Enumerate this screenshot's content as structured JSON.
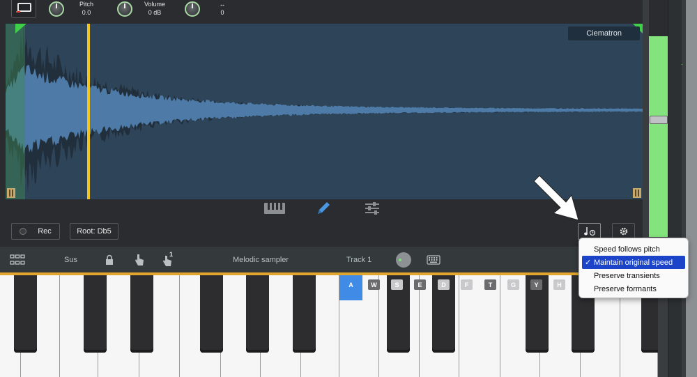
{
  "topbar": {
    "pitch": {
      "label": "Pitch",
      "value": "0.0"
    },
    "volume": {
      "label": "Volume",
      "value": "0 dB"
    },
    "pan": {
      "label": "↔",
      "value": "0"
    }
  },
  "waveform": {
    "sample_name": "Ciematron"
  },
  "modes": [
    "piano-keys-icon",
    "pencil-icon",
    "sliders-icon"
  ],
  "controls": {
    "rec_label": "Rec",
    "root_label": "Root: Db5"
  },
  "toolbar": {
    "sus_label": "Sus",
    "latch_badge": "1",
    "instrument_label": "Melodic sampler",
    "track_label": "Track 1"
  },
  "keyboard": {
    "key_labels": [
      "A",
      "W",
      "S",
      "E",
      "D",
      "F",
      "T",
      "G",
      "Y",
      "H"
    ],
    "active_key": "A"
  },
  "stretch_menu": {
    "options": [
      "Speed follows pitch",
      "Maintain original speed",
      "Preserve transients",
      "Preserve formants"
    ],
    "selected": "Maintain original speed",
    "check_glyph": "✓"
  },
  "colors": {
    "accent_orange": "#e0a52c",
    "playhead_yellow": "#f2c51f",
    "meter_green": "#84e37c",
    "waveform_fill": "#4d7aa6",
    "waveform_bg": "#2e4458",
    "menu_selected": "#1b44c9",
    "active_key_blue": "#3f8be6"
  }
}
